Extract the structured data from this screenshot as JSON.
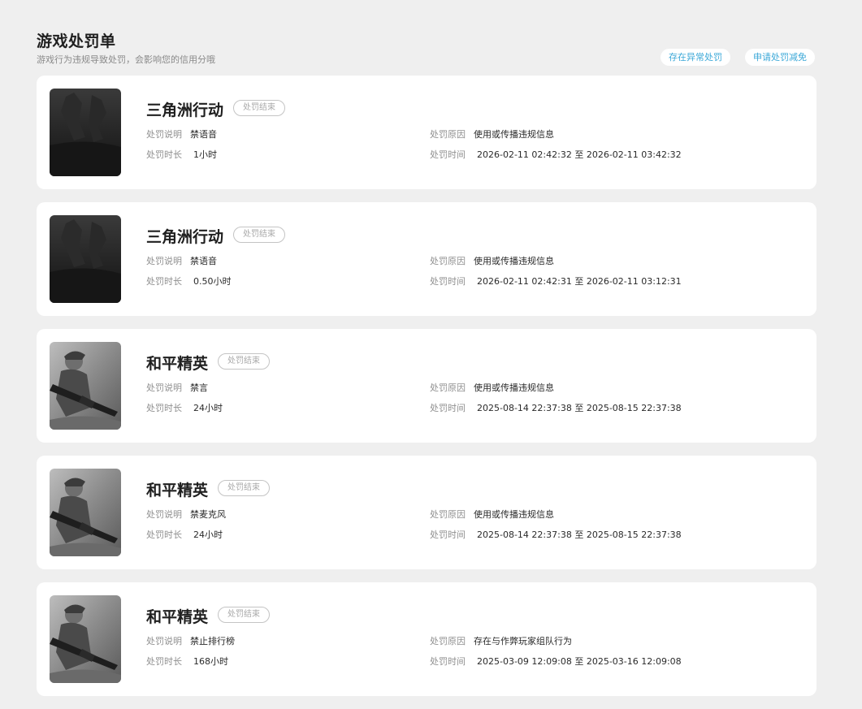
{
  "header": {
    "title": "游戏处罚单",
    "subtitle": "游戏行为违规导致处罚，会影响您的信用分哦",
    "btn_abnormal": "存在异常处罚",
    "btn_reduce": "申请处罚减免"
  },
  "labels": {
    "desc": "处罚说明",
    "duration": "处罚时长",
    "reason": "处罚原因",
    "time": "处罚时间"
  },
  "records": [
    {
      "game": "三角洲行动",
      "status": "处罚结束",
      "desc": "禁语音",
      "duration": "1小时",
      "reason": "使用或传播违规信息",
      "time": "2026-02-11 02:42:32 至 2026-02-11 03:42:32",
      "cover_icon": "delta-force-cover"
    },
    {
      "game": "三角洲行动",
      "status": "处罚结束",
      "desc": "禁语音",
      "duration": "0.50小时",
      "reason": "使用或传播违规信息",
      "time": "2026-02-11 02:42:31 至 2026-02-11 03:12:31",
      "cover_icon": "delta-force-cover"
    },
    {
      "game": "和平精英",
      "status": "处罚结束",
      "desc": "禁言",
      "duration": "24小时",
      "reason": "使用或传播违规信息",
      "time": "2025-08-14 22:37:38 至 2025-08-15 22:37:38",
      "cover_icon": "peace-elite-cover"
    },
    {
      "game": "和平精英",
      "status": "处罚结束",
      "desc": "禁麦克风",
      "duration": "24小时",
      "reason": "使用或传播违规信息",
      "time": "2025-08-14 22:37:38 至 2025-08-15 22:37:38",
      "cover_icon": "peace-elite-cover"
    },
    {
      "game": "和平精英",
      "status": "处罚结束",
      "desc": "禁止排行榜",
      "duration": "168小时",
      "reason": "存在与作弊玩家组队行为",
      "time": "2025-03-09 12:09:08 至 2025-03-16 12:09:08",
      "cover_icon": "peace-elite-cover"
    }
  ],
  "colors": {
    "page_bg": "#efefef",
    "card_bg": "#ffffff",
    "accent": "#3ba8d8",
    "tag_border": "#c4c4c4"
  }
}
